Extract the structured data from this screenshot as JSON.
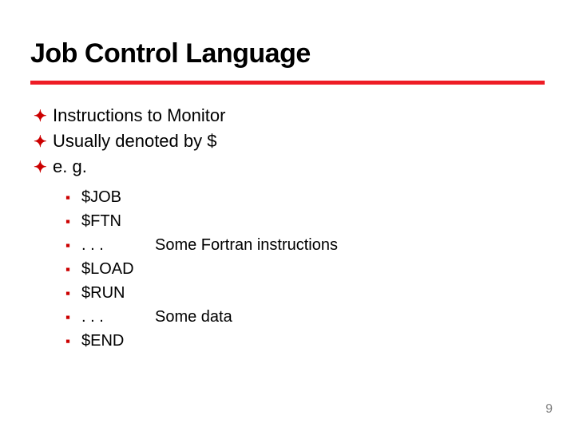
{
  "title": "Job Control Language",
  "bullets": [
    {
      "text": "Instructions to Monitor"
    },
    {
      "text": "Usually denoted by $"
    },
    {
      "text": "e. g."
    }
  ],
  "sub_bullets": [
    {
      "code": "$JOB",
      "extra": ""
    },
    {
      "code": "$FTN",
      "extra": ""
    },
    {
      "code": ". . .",
      "extra": "Some Fortran instructions"
    },
    {
      "code": "$LOAD",
      "extra": ""
    },
    {
      "code": "$RUN",
      "extra": ""
    },
    {
      "code": ". . .",
      "extra": "Some data"
    },
    {
      "code": "$END",
      "extra": ""
    }
  ],
  "glyphs": {
    "level1": "❚",
    "level2": "❙"
  },
  "page_number": "9"
}
